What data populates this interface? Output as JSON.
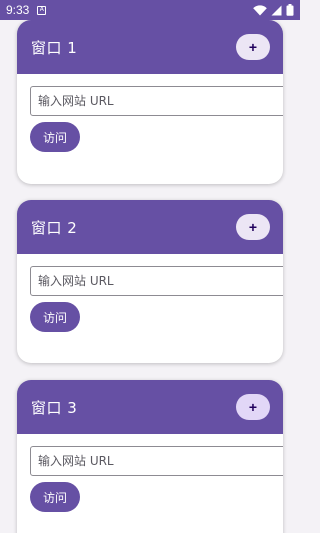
{
  "status_bar": {
    "time": "9:33",
    "notification_icon": "A",
    "icons": [
      "wifi-icon",
      "signal-icon",
      "battery-icon"
    ]
  },
  "windows": [
    {
      "title": "窗口 1",
      "add_label": "+",
      "url_placeholder": "输入网站 URL",
      "visit_label": "访问"
    },
    {
      "title": "窗口 2",
      "add_label": "+",
      "url_placeholder": "输入网站 URL",
      "visit_label": "访问"
    },
    {
      "title": "窗口 3",
      "add_label": "+",
      "url_placeholder": "输入网站 URL",
      "visit_label": "访问"
    }
  ],
  "colors": {
    "primary": "#6650a4",
    "tonal_button": "#ece6f5",
    "background": "#f4f2f6"
  }
}
